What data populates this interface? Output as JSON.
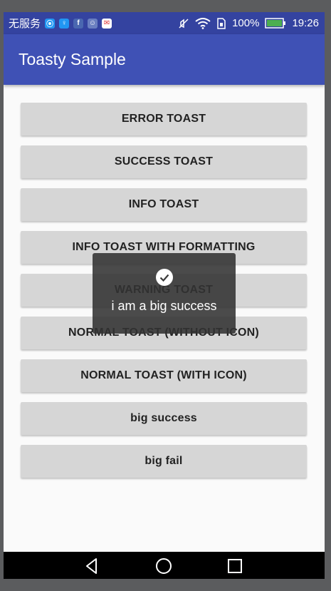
{
  "status_bar": {
    "carrier": "无服务",
    "battery": "100%",
    "time": "19:26",
    "notification_icons": [
      "location-icon",
      "lightbulb-icon",
      "facebook-icon",
      "app-icon",
      "mail-icon"
    ],
    "system_icons": [
      "mute-icon",
      "wifi-icon",
      "sim-icon",
      "battery-icon"
    ]
  },
  "app_bar": {
    "title": "Toasty Sample"
  },
  "buttons": [
    {
      "label": "ERROR TOAST"
    },
    {
      "label": "SUCCESS TOAST"
    },
    {
      "label": "INFO TOAST"
    },
    {
      "label": "INFO TOAST WITH FORMATTING"
    },
    {
      "label": "WARNING TOAST"
    },
    {
      "label": "NORMAL TOAST (WITHOUT ICON)"
    },
    {
      "label": "NORMAL TOAST (WITH ICON)"
    },
    {
      "label": "big success"
    },
    {
      "label": "big fail"
    }
  ],
  "toast": {
    "message": "i am a big success",
    "icon": "check-circle-icon"
  },
  "nav_bar": {
    "buttons": [
      "back-icon",
      "home-icon",
      "recents-icon"
    ]
  },
  "colors": {
    "status_bar": "#3443a0",
    "app_bar": "#3f51b5",
    "button": "#d6d6d6",
    "toast": "#323232"
  }
}
